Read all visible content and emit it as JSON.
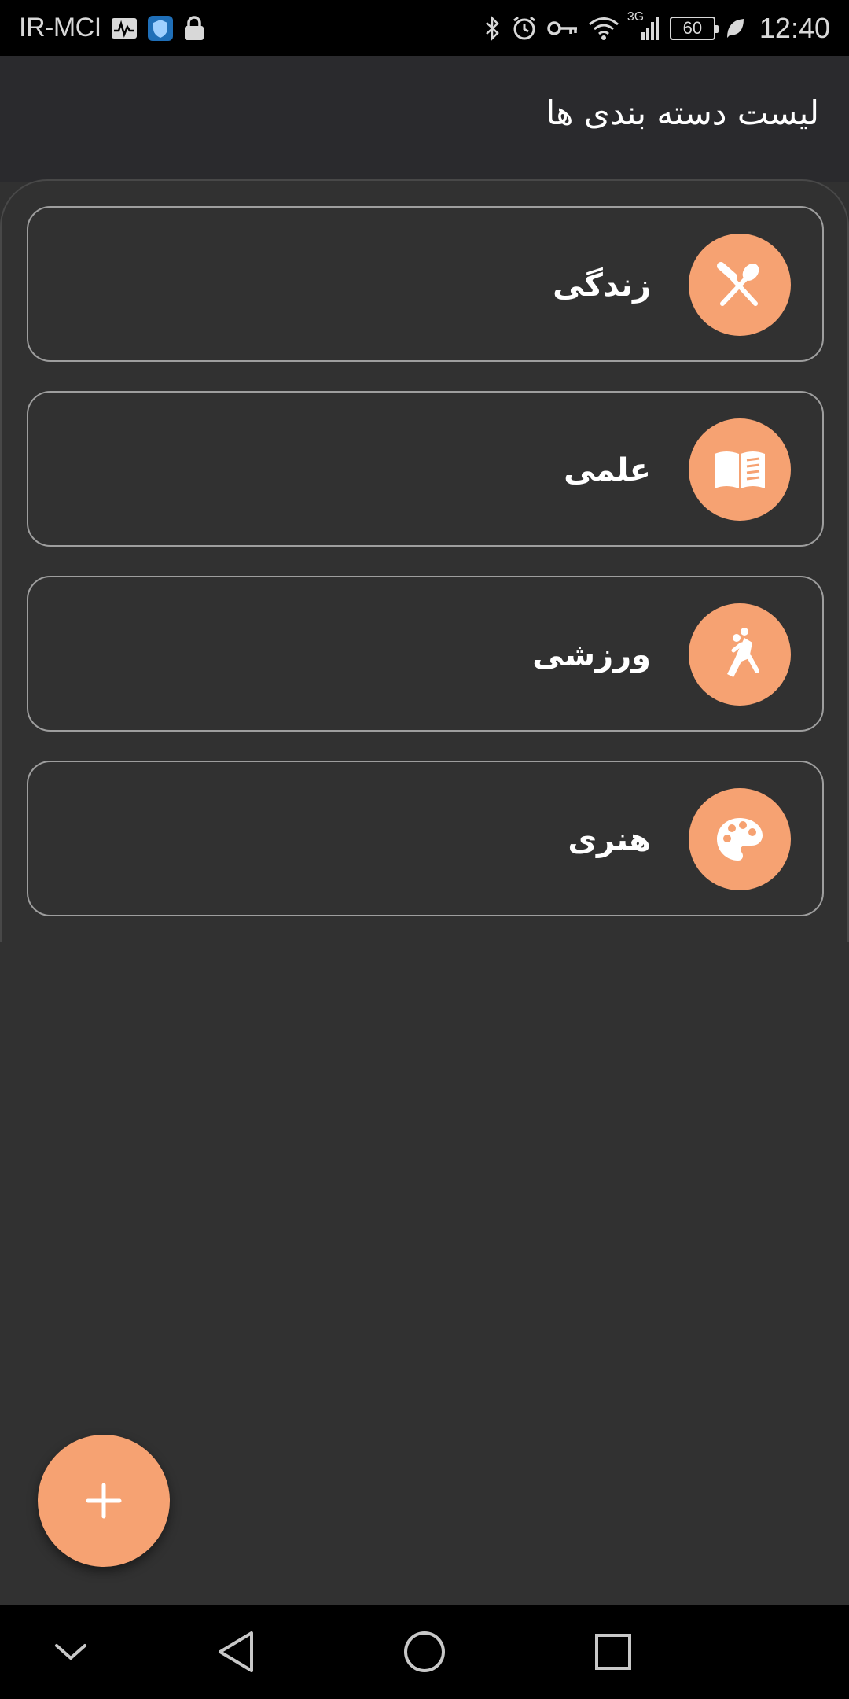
{
  "status_bar": {
    "carrier": "IR-MCI",
    "time": "12:40",
    "battery": "60",
    "network": "3G",
    "icons": [
      "activity-icon",
      "shield-icon",
      "lock-icon",
      "bluetooth-icon",
      "alarm-icon",
      "key-icon",
      "wifi-icon",
      "signal-icon",
      "battery-icon",
      "leaf-icon"
    ]
  },
  "app_bar": {
    "title": "لیست دسته بندی ها"
  },
  "categories": [
    {
      "label": "زندگی",
      "icon": "utensils-icon"
    },
    {
      "label": "علمی",
      "icon": "book-icon"
    },
    {
      "label": "ورزشی",
      "icon": "volleyball-player-icon"
    },
    {
      "label": "هنری",
      "icon": "palette-icon"
    }
  ],
  "fab": {
    "icon": "plus-icon"
  },
  "nav_bar": {
    "icons": [
      "chevron-down-icon",
      "back-icon",
      "home-icon",
      "recents-icon"
    ]
  },
  "colors": {
    "accent": "#f6a272",
    "background": "#313131",
    "app_bar": "#2a2a2d",
    "card_border": "#9e9e9e"
  }
}
